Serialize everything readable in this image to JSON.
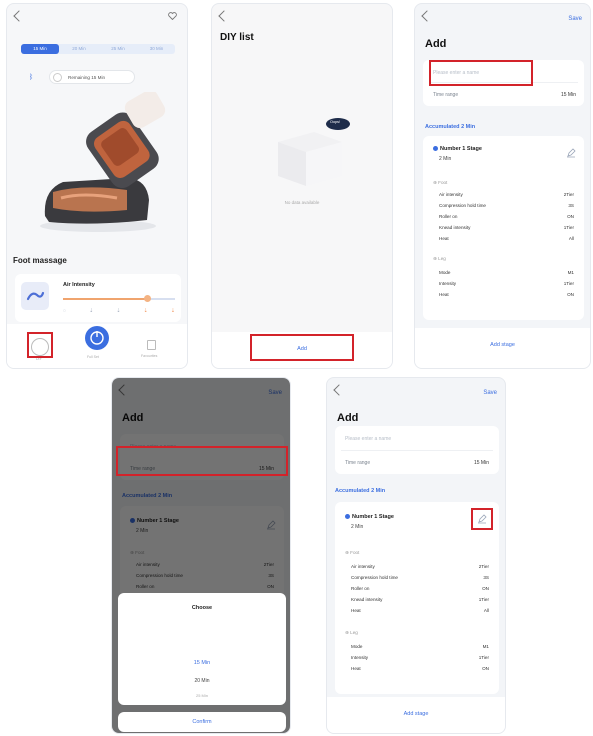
{
  "p1": {
    "tabs": [
      "15 Min",
      "20 Min",
      "25 Min",
      "30 Min"
    ],
    "remaining": "Remaining 15 Min",
    "section_title": "Foot massage",
    "control_label": "Air Intensity",
    "nav": [
      {
        "label": "DIY"
      },
      {
        "label": "Full Set"
      },
      {
        "label": "Favourites"
      }
    ]
  },
  "p2": {
    "title": "DIY list",
    "bubble": "Oops!",
    "empty": "No data available",
    "add_label": "Add"
  },
  "add_screen": {
    "save": "Save",
    "title": "Add",
    "name_placeholder": "Please enter a name",
    "time_label": "Time range",
    "time_value": "15 Min",
    "accumulated": "Accumulated 2 Min",
    "stage_title": "Number 1 Stage",
    "stage_duration": "2 Min",
    "foot_group": "Foot",
    "foot_rows": [
      {
        "label": "Air intensity",
        "value": "2Tier"
      },
      {
        "label": "Compression hold time",
        "value": "3S"
      },
      {
        "label": "Roller on",
        "value": "ON"
      },
      {
        "label": "Knead intensity",
        "value": "1Tier"
      },
      {
        "label": "Heat",
        "value": "All"
      }
    ],
    "leg_group": "Leg",
    "leg_rows": [
      {
        "label": "Mode",
        "value": "M1"
      },
      {
        "label": "Intensity",
        "value": "1Tier"
      },
      {
        "label": "Heat",
        "value": "ON"
      }
    ],
    "add_stage": "Add stage"
  },
  "p4": {
    "choose_title": "Choose",
    "options": [
      "15 Min",
      "20 Min",
      "25 Min"
    ],
    "confirm": "Confirm"
  },
  "colors": {
    "accent": "#3b6ee0",
    "highlight": "#d3232a"
  }
}
